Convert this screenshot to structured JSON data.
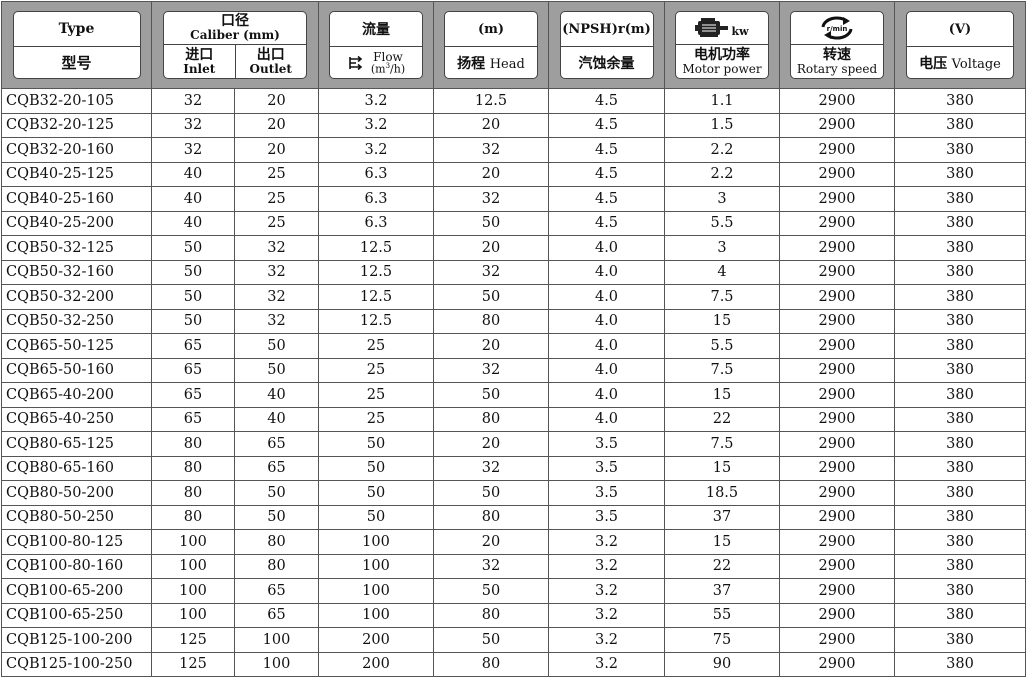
{
  "headers": {
    "type": {
      "en": "Type",
      "cn": "型号"
    },
    "caliber": {
      "cn": "口径",
      "en": "Caliber (mm)",
      "inlet_cn": "进口",
      "inlet_en": "Inlet",
      "outlet_cn": "出口",
      "outlet_en": "Outlet"
    },
    "flow": {
      "cn": "流量",
      "en": "Flow",
      "unit_pre": "(m",
      "unit_sup": "3",
      "unit_post": "/h)",
      "icon": "flow-arrows-icon"
    },
    "head": {
      "unit": "(m)",
      "cn": "扬程",
      "en": "Head"
    },
    "npsh": {
      "unit": "(NPSH)r(m)",
      "cn": "汽蚀余量"
    },
    "power": {
      "icon": "motor-icon",
      "unit": "kw",
      "cn": "电机功率",
      "en": "Motor power"
    },
    "speed": {
      "icon": "rotation-icon",
      "icon_label": "r/min",
      "cn": "转速",
      "en": "Rotary speed"
    },
    "voltage": {
      "unit": "(V)",
      "cn": "电压",
      "en": "Voltage"
    }
  },
  "columns": [
    "model",
    "inlet",
    "outlet",
    "flow",
    "head",
    "npsh",
    "power",
    "speed",
    "voltage"
  ],
  "rows": [
    [
      "CQB32-20-105",
      "32",
      "20",
      "3.2",
      "12.5",
      "4.5",
      "1.1",
      "2900",
      "380"
    ],
    [
      "CQB32-20-125",
      "32",
      "20",
      "3.2",
      "20",
      "4.5",
      "1.5",
      "2900",
      "380"
    ],
    [
      "CQB32-20-160",
      "32",
      "20",
      "3.2",
      "32",
      "4.5",
      "2.2",
      "2900",
      "380"
    ],
    [
      "CQB40-25-125",
      "40",
      "25",
      "6.3",
      "20",
      "4.5",
      "2.2",
      "2900",
      "380"
    ],
    [
      "CQB40-25-160",
      "40",
      "25",
      "6.3",
      "32",
      "4.5",
      "3",
      "2900",
      "380"
    ],
    [
      "CQB40-25-200",
      "40",
      "25",
      "6.3",
      "50",
      "4.5",
      "5.5",
      "2900",
      "380"
    ],
    [
      "CQB50-32-125",
      "50",
      "32",
      "12.5",
      "20",
      "4.0",
      "3",
      "2900",
      "380"
    ],
    [
      "CQB50-32-160",
      "50",
      "32",
      "12.5",
      "32",
      "4.0",
      "4",
      "2900",
      "380"
    ],
    [
      "CQB50-32-200",
      "50",
      "32",
      "12.5",
      "50",
      "4.0",
      "7.5",
      "2900",
      "380"
    ],
    [
      "CQB50-32-250",
      "50",
      "32",
      "12.5",
      "80",
      "4.0",
      "15",
      "2900",
      "380"
    ],
    [
      "CQB65-50-125",
      "65",
      "50",
      "25",
      "20",
      "4.0",
      "5.5",
      "2900",
      "380"
    ],
    [
      "CQB65-50-160",
      "65",
      "50",
      "25",
      "32",
      "4.0",
      "7.5",
      "2900",
      "380"
    ],
    [
      "CQB65-40-200",
      "65",
      "40",
      "25",
      "50",
      "4.0",
      "15",
      "2900",
      "380"
    ],
    [
      "CQB65-40-250",
      "65",
      "40",
      "25",
      "80",
      "4.0",
      "22",
      "2900",
      "380"
    ],
    [
      "CQB80-65-125",
      "80",
      "65",
      "50",
      "20",
      "3.5",
      "7.5",
      "2900",
      "380"
    ],
    [
      "CQB80-65-160",
      "80",
      "65",
      "50",
      "32",
      "3.5",
      "15",
      "2900",
      "380"
    ],
    [
      "CQB80-50-200",
      "80",
      "50",
      "50",
      "50",
      "3.5",
      "18.5",
      "2900",
      "380"
    ],
    [
      "CQB80-50-250",
      "80",
      "50",
      "50",
      "80",
      "3.5",
      "37",
      "2900",
      "380"
    ],
    [
      "CQB100-80-125",
      "100",
      "80",
      "100",
      "20",
      "3.2",
      "15",
      "2900",
      "380"
    ],
    [
      "CQB100-80-160",
      "100",
      "80",
      "100",
      "32",
      "3.2",
      "22",
      "2900",
      "380"
    ],
    [
      "CQB100-65-200",
      "100",
      "65",
      "100",
      "50",
      "3.2",
      "37",
      "2900",
      "380"
    ],
    [
      "CQB100-65-250",
      "100",
      "65",
      "100",
      "80",
      "3.2",
      "55",
      "2900",
      "380"
    ],
    [
      "CQB125-100-200",
      "125",
      "100",
      "200",
      "50",
      "3.2",
      "75",
      "2900",
      "380"
    ],
    [
      "CQB125-100-250",
      "125",
      "100",
      "200",
      "80",
      "3.2",
      "90",
      "2900",
      "380"
    ]
  ]
}
